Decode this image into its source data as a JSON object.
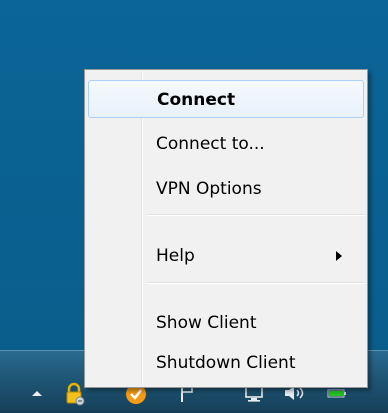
{
  "menu": {
    "items": [
      {
        "label": "Connect"
      },
      {
        "label": "Connect to..."
      },
      {
        "label": "VPN Options"
      },
      {
        "label": "Help"
      },
      {
        "label": "Show Client"
      },
      {
        "label": "Shutdown Client"
      }
    ]
  },
  "tray": {
    "icons": [
      "show-hidden-icons-arrow",
      "vpn-lock-icon",
      "shield-icon",
      "network-flag-icon",
      "monitor-icon",
      "speaker-icon",
      "battery-icon"
    ]
  },
  "colors": {
    "desktop": "#0a5f8f",
    "menu_bg": "#f1f1f1",
    "highlight_border": "#aecff7"
  }
}
